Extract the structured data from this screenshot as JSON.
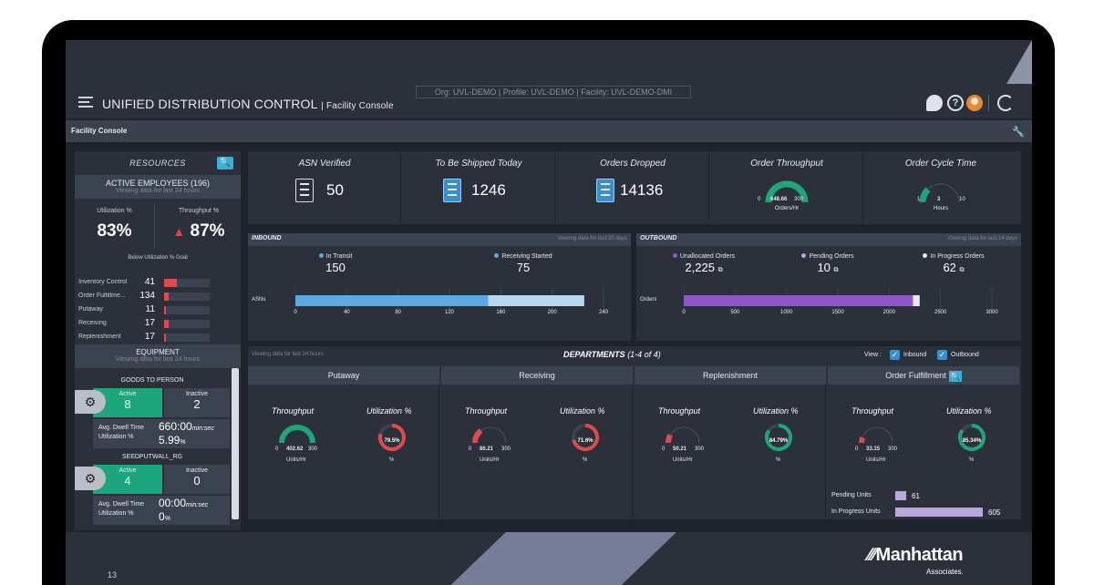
{
  "app": {
    "title": "UNIFIED DISTRIBUTION CONTROL",
    "subtitle": "| Facility Console",
    "org_bar": "Org: UVL-DEMO  |  Profile: UVL-DEMO  |  Facility: UVL-DEMO-DMI",
    "page_title": "Facility Console"
  },
  "colors": {
    "accent_teal": "#1ea67b",
    "accent_blue": "#3a8fd1",
    "alert_red": "#e24a4a",
    "purple": "#8e56c7"
  },
  "resources": {
    "title": "RESOURCES",
    "employees_title": "ACTIVE EMPLOYEES (196)",
    "employees_sub": "Viewing data for last 24 hours",
    "util_label": "Utilization %",
    "util_value": "83%",
    "thru_label": "Throughput %",
    "thru_value": "87%",
    "below_goal": "Below Utilization % Goal",
    "rows": [
      {
        "name": "Inventory Control",
        "count": "41",
        "frac": 0.28
      },
      {
        "name": "Order Fulfillme...",
        "count": "134",
        "frac": 0.1
      },
      {
        "name": "Putaway",
        "count": "11",
        "frac": 0.03
      },
      {
        "name": "Receiving",
        "count": "17",
        "frac": 0.1
      },
      {
        "name": "Replenishment",
        "count": "17",
        "frac": 0.03
      }
    ]
  },
  "equipment": {
    "title": "EQUIPMENT",
    "sub": "Viewing data for last 24 hours",
    "groups": [
      {
        "name": "GOODS TO PERSON",
        "active_label": "Active",
        "active": "8",
        "inactive_label": "Inactive",
        "inactive": "2",
        "dwell_label": "Avg. Dwell Time",
        "util_label": "Utilization %",
        "dwell": "660:00",
        "dwell_unit": "min:sec",
        "util": "5.99",
        "util_unit": "%"
      },
      {
        "name": "SEEDPUTWALL_RG",
        "active_label": "Active",
        "active": "4",
        "inactive_label": "Inactive",
        "inactive": "0",
        "dwell_label": "Avg. Dwell Time",
        "util_label": "Utilization %",
        "dwell": "00:00",
        "dwell_unit": "min:sec",
        "util": "0",
        "util_unit": "%"
      }
    ]
  },
  "kpis": {
    "asn_verified": {
      "title": "ASN Verified",
      "value": "50"
    },
    "to_be_shipped": {
      "title": "To Be Shipped Today",
      "value": "1246"
    },
    "orders_dropped": {
      "title": "Orders Dropped",
      "value": "14136"
    },
    "order_throughput": {
      "title": "Order Throughput",
      "min": "0",
      "value": "648.66",
      "max": "300",
      "unit": "Orders/Hr"
    },
    "order_cycle": {
      "title": "Order Cycle Time",
      "min": "1",
      "value": "3",
      "max": "10",
      "unit": "Hours"
    }
  },
  "inbound": {
    "title": "INBOUND",
    "sub": "Viewing data for last 30 days",
    "in_transit_label": "In Transit",
    "in_transit": "150",
    "receiving_label": "Receiving Started",
    "receiving": "75",
    "axis_label": "ASNs",
    "ticks": [
      "0",
      "40",
      "80",
      "120",
      "160",
      "200",
      "240"
    ],
    "chart_data": {
      "type": "bar",
      "categories": [
        "ASNs"
      ],
      "series": [
        {
          "name": "In Transit",
          "values": [
            150
          ]
        },
        {
          "name": "Receiving Started",
          "values": [
            75
          ]
        }
      ],
      "xlim": [
        0,
        240
      ],
      "stacked": true
    }
  },
  "outbound": {
    "title": "OUTBOUND",
    "sub": "Viewing data for last 14 days",
    "unalloc_label": "Unallocated Orders",
    "unalloc": "2,225",
    "pending_label": "Pending Orders",
    "pending": "10",
    "inprog_label": "In Progress Orders",
    "inprog": "62",
    "axis_label": "Orders",
    "ticks": [
      "0",
      "500",
      "1000",
      "1500",
      "2000",
      "2500",
      "3000"
    ],
    "chart_data": {
      "type": "bar",
      "categories": [
        "Orders"
      ],
      "series": [
        {
          "name": "Unallocated Orders",
          "values": [
            2225
          ]
        },
        {
          "name": "Pending Orders",
          "values": [
            10
          ]
        },
        {
          "name": "In Progress Orders",
          "values": [
            62
          ]
        }
      ],
      "xlim": [
        0,
        3000
      ],
      "stacked": true
    }
  },
  "departments": {
    "sub": "Viewing data for last 24 hours",
    "title": "DEPARTMENTS",
    "count": "(1-4 of 4)",
    "view_label": "View :",
    "inbound_label": "Inbound",
    "outbound_label": "Outbound",
    "throughput_label": "Throughput",
    "util_label": "Utilization %",
    "units_hr": "Units/Hr",
    "pct": "%",
    "items": [
      {
        "name": "Putaway",
        "min": "0",
        "thru": "402.62",
        "max": "300",
        "util": "79.5%",
        "util_frac": 0.795,
        "thru_frac": 1.0
      },
      {
        "name": "Receiving",
        "min": "0",
        "thru": "86.21",
        "max": "300",
        "util": "71.6%",
        "util_frac": 0.716,
        "thru_frac": 0.29
      },
      {
        "name": "Replenishment",
        "min": "0",
        "thru": "50.21",
        "max": "300",
        "util": "84.79%",
        "util_frac": 0.848,
        "thru_frac": 0.17
      },
      {
        "name": "Order Fulfillment",
        "min": "0",
        "thru": "33.15",
        "max": "300",
        "util": "85.34%",
        "util_frac": 0.853,
        "thru_frac": 0.11
      }
    ],
    "pending_units_label": "Pending Units",
    "pending_units": "61",
    "inprog_units_label": "In Progress Units",
    "inprog_units": "605"
  },
  "footer": {
    "slide": "13",
    "logo": "Manhattan",
    "logo_sub": "Associates."
  }
}
